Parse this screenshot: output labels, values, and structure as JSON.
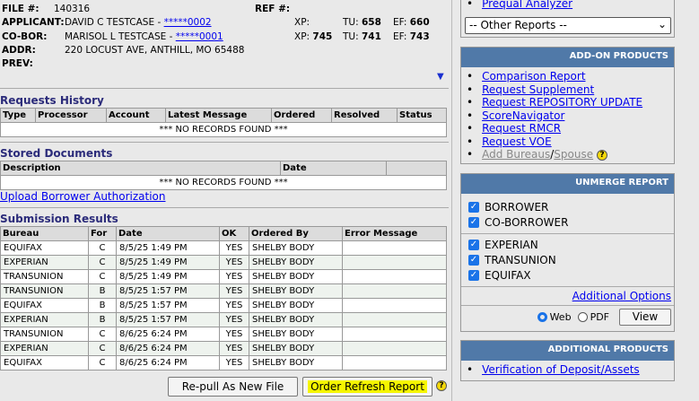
{
  "header": {
    "file_label": "FILE #:",
    "file_value": "140316",
    "ref_label": "REF #:",
    "applicant_label": "APPLICANT:",
    "applicant_name": "DAVID C TESTCASE - ",
    "applicant_ssn": "*****0002",
    "coborrower_label": "CO-BOR:",
    "coborrower_name": "MARISOL L TESTCASE - ",
    "coborrower_ssn": "*****0001",
    "addr_label": "ADDR:",
    "addr_value": "220 LOCUST AVE, ANTHILL, MO 65488",
    "prev_label": "PREV:",
    "applicant_scores": {
      "xp_label": "XP:",
      "xp": "",
      "tu_label": "TU:",
      "tu": "658",
      "ef_label": "EF:",
      "ef": "660"
    },
    "coborrower_scores": {
      "xp_label": "XP:",
      "xp": "745",
      "tu_label": "TU:",
      "tu": "741",
      "ef_label": "EF:",
      "ef": "743"
    }
  },
  "requests": {
    "title": "Requests History",
    "columns": [
      "Type",
      "Processor",
      "Account",
      "Latest Message",
      "Ordered",
      "Resolved",
      "Status"
    ],
    "empty": "*** NO RECORDS FOUND ***"
  },
  "stored": {
    "title": "Stored Documents",
    "columns": [
      "Description",
      "Date",
      ""
    ],
    "empty": "*** NO RECORDS FOUND ***",
    "upload_link": "Upload Borrower Authorization"
  },
  "submission": {
    "title": "Submission Results",
    "columns": [
      "Bureau",
      "For",
      "Date",
      "OK",
      "Ordered By",
      "Error Message"
    ],
    "rows": [
      [
        "EQUIFAX",
        "C",
        "8/5/25 1:49 PM",
        "YES",
        "SHELBY BODY",
        ""
      ],
      [
        "EXPERIAN",
        "C",
        "8/5/25 1:49 PM",
        "YES",
        "SHELBY BODY",
        ""
      ],
      [
        "TRANSUNION",
        "C",
        "8/5/25 1:49 PM",
        "YES",
        "SHELBY BODY",
        ""
      ],
      [
        "TRANSUNION",
        "B",
        "8/5/25 1:57 PM",
        "YES",
        "SHELBY BODY",
        ""
      ],
      [
        "EQUIFAX",
        "B",
        "8/5/25 1:57 PM",
        "YES",
        "SHELBY BODY",
        ""
      ],
      [
        "EXPERIAN",
        "B",
        "8/5/25 1:57 PM",
        "YES",
        "SHELBY BODY",
        ""
      ],
      [
        "TRANSUNION",
        "C",
        "8/6/25 6:24 PM",
        "YES",
        "SHELBY BODY",
        ""
      ],
      [
        "EXPERIAN",
        "C",
        "8/6/25 6:24 PM",
        "YES",
        "SHELBY BODY",
        ""
      ],
      [
        "EQUIFAX",
        "C",
        "8/6/25 6:24 PM",
        "YES",
        "SHELBY BODY",
        ""
      ]
    ],
    "repull_label": "Re-pull As New File",
    "refresh_label": "Order Refresh Report",
    "help": "?"
  },
  "sidebar": {
    "prequal_link": "Prequal Analyzer",
    "other_reports": "-- Other Reports --",
    "addon_title": "ADD-ON PRODUCTS",
    "addon_links": [
      "Comparison Report",
      "Request Supplement",
      "Request REPOSITORY UPDATE",
      "ScoreNavigator",
      "Request RMCR",
      "Request VOE"
    ],
    "add_bureaus": "Add Bureaus",
    "slash": "/",
    "spouse": "Spouse",
    "help": "?",
    "unmerge_title": "UNMERGE REPORT",
    "parties": [
      "BORROWER",
      "CO-BORROWER"
    ],
    "bureaus": [
      "EXPERIAN",
      "TRANSUNION",
      "EQUIFAX"
    ],
    "additional_options": "Additional Options",
    "format_web": "Web",
    "format_pdf": "PDF",
    "view_label": "View",
    "additional_title": "ADDITIONAL PRODUCTS",
    "additional_links": [
      "Verification of Deposit/Assets"
    ]
  },
  "colors": {
    "header_blue": "#5079a8",
    "link": "#0000ee",
    "highlight": "#f5f500"
  }
}
